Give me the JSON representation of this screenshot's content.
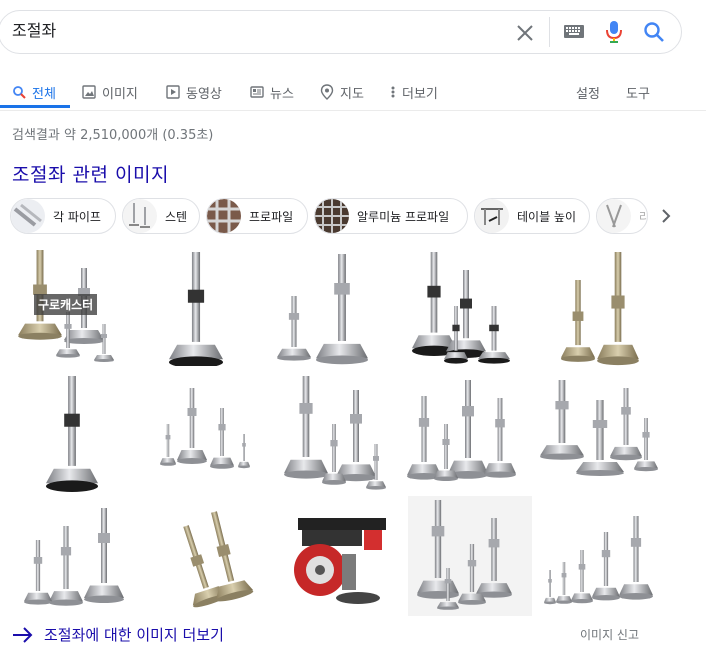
{
  "search": {
    "query": "조절좌"
  },
  "tabs": [
    {
      "label": "전체"
    },
    {
      "label": "이미지"
    },
    {
      "label": "동영상"
    },
    {
      "label": "뉴스"
    },
    {
      "label": "지도"
    },
    {
      "label": "더보기"
    }
  ],
  "tools": {
    "settings": "설정",
    "tools": "도구"
  },
  "stats": "검색결과 약 2,510,000개 (0.35초)",
  "section_title": "조절좌 관련 이미지",
  "chips": [
    {
      "label": "각 파이프"
    },
    {
      "label": "스텐"
    },
    {
      "label": "프로파일"
    },
    {
      "label": "알루미늄 프로파일"
    },
    {
      "label": "테이블 높이"
    },
    {
      "label": "라"
    }
  ],
  "overlay_label": "구로캐스터",
  "more_link": "조절좌에 대한 이미지 더보기",
  "report": "이미지 신고",
  "colors": {
    "accent": "#1a73e8",
    "link": "#1a0dab",
    "muted": "#70757a"
  },
  "icons": [
    "clear-icon",
    "keyboard-icon",
    "mic-icon",
    "search-icon",
    "image-icon",
    "video-icon",
    "news-icon",
    "map-pin-icon",
    "more-vert-icon",
    "chevron-right-icon",
    "arrow-right-icon"
  ]
}
